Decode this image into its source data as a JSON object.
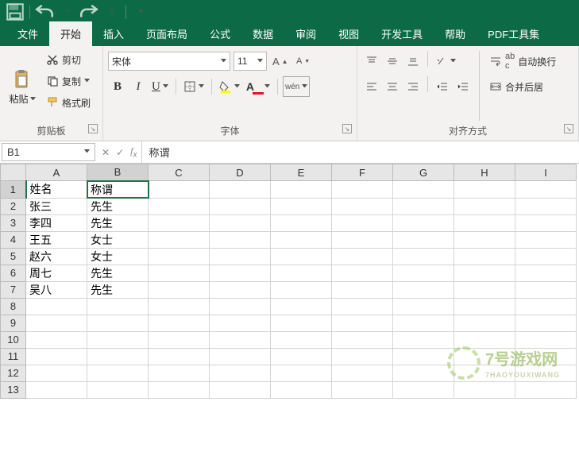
{
  "qat": {},
  "tabs": [
    {
      "label": "文件"
    },
    {
      "label": "开始",
      "active": true
    },
    {
      "label": "插入"
    },
    {
      "label": "页面布局"
    },
    {
      "label": "公式"
    },
    {
      "label": "数据"
    },
    {
      "label": "审阅"
    },
    {
      "label": "视图"
    },
    {
      "label": "开发工具"
    },
    {
      "label": "帮助"
    },
    {
      "label": "PDF工具集"
    }
  ],
  "clipboard": {
    "paste": "粘贴",
    "cut": "剪切",
    "copy": "复制",
    "painter": "格式刷",
    "group": "剪贴板"
  },
  "font": {
    "name": "宋体",
    "size": "11",
    "group": "字体"
  },
  "align": {
    "group": "对齐方式",
    "wrap": "自动换行",
    "merge": "合并后居"
  },
  "namebox": "B1",
  "formula": "称谓",
  "columns": [
    "A",
    "B",
    "C",
    "D",
    "E",
    "F",
    "G",
    "H",
    "I"
  ],
  "rows": [
    "1",
    "2",
    "3",
    "4",
    "5",
    "6",
    "7",
    "8",
    "9",
    "10",
    "11",
    "12",
    "13"
  ],
  "selected": {
    "col": 1,
    "row": 0
  },
  "cells": [
    [
      "姓名",
      "称谓",
      "",
      "",
      "",
      "",
      "",
      "",
      ""
    ],
    [
      "张三",
      "先生",
      "",
      "",
      "",
      "",
      "",
      "",
      ""
    ],
    [
      "李四",
      "先生",
      "",
      "",
      "",
      "",
      "",
      "",
      ""
    ],
    [
      "王五",
      "女士",
      "",
      "",
      "",
      "",
      "",
      "",
      ""
    ],
    [
      "赵六",
      "女士",
      "",
      "",
      "",
      "",
      "",
      "",
      ""
    ],
    [
      "周七",
      "先生",
      "",
      "",
      "",
      "",
      "",
      "",
      ""
    ],
    [
      "吴八",
      "先生",
      "",
      "",
      "",
      "",
      "",
      "",
      ""
    ],
    [
      "",
      "",
      "",
      "",
      "",
      "",
      "",
      "",
      ""
    ],
    [
      "",
      "",
      "",
      "",
      "",
      "",
      "",
      "",
      ""
    ],
    [
      "",
      "",
      "",
      "",
      "",
      "",
      "",
      "",
      ""
    ],
    [
      "",
      "",
      "",
      "",
      "",
      "",
      "",
      "",
      ""
    ],
    [
      "",
      "",
      "",
      "",
      "",
      "",
      "",
      "",
      ""
    ],
    [
      "",
      "",
      "",
      "",
      "",
      "",
      "",
      "",
      ""
    ]
  ],
  "watermark": {
    "text": "7号游戏网",
    "sub": "7HAOYOUXIWANG"
  }
}
